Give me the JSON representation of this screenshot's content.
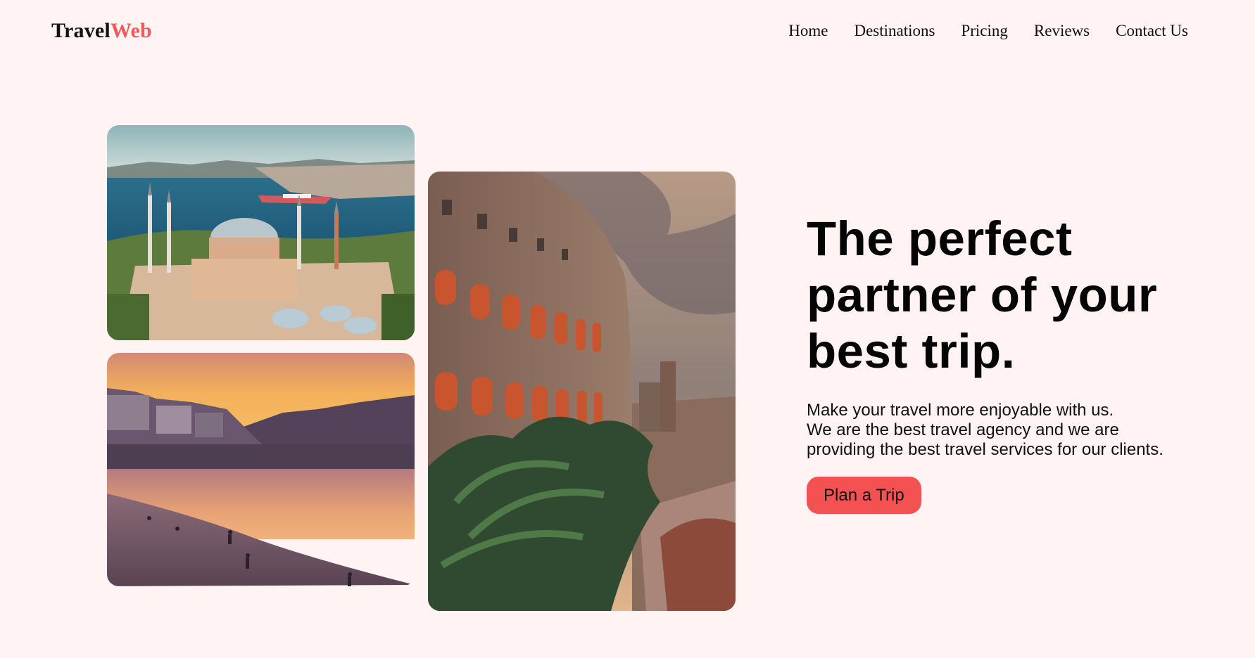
{
  "brand": {
    "name_part1": "Travel",
    "name_part2": "Web",
    "accent_color": "#f25a5a"
  },
  "nav": {
    "items": [
      {
        "label": "Home"
      },
      {
        "label": "Destinations"
      },
      {
        "label": "Pricing"
      },
      {
        "label": "Reviews"
      },
      {
        "label": "Contact Us"
      }
    ]
  },
  "gallery": {
    "images": [
      {
        "subject": "Hagia Sophia, Istanbul"
      },
      {
        "subject": "beach at sunset"
      },
      {
        "subject": "Colosseum, Rome"
      }
    ]
  },
  "hero": {
    "headline_line1": "The perfect",
    "headline_line2": "partner of your",
    "headline_line3": "best trip.",
    "description_lines": [
      "Make your travel more enjoyable with us.",
      "We are the best travel agency and we are",
      "providing the best travel services for our clients."
    ],
    "cta_label": "Plan a Trip",
    "cta_color": "#f45252"
  },
  "colors": {
    "background": "#fff4f3",
    "text": "#111111"
  }
}
